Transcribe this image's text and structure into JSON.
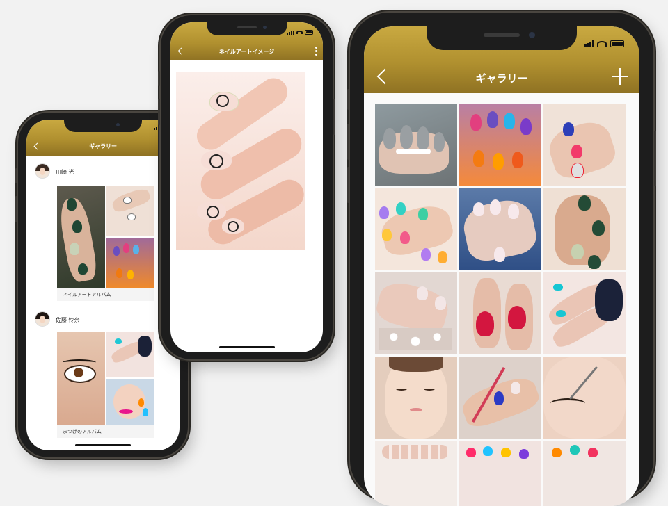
{
  "phones": {
    "left": {
      "nav": {
        "title": "ギャラリー"
      },
      "feed": [
        {
          "user": "川崎 光",
          "album": "ネイルアートアルバム"
        },
        {
          "user": "佐藤 怜奈",
          "album": "まつげのアルバム"
        }
      ]
    },
    "middle": {
      "nav": {
        "title": "ネイルアートイメージ"
      }
    },
    "right": {
      "nav": {
        "title": "ギャラリー"
      },
      "grid_rows": 5,
      "grid_cols": 3
    }
  },
  "colors": {
    "gold_top": "#c9a941",
    "gold_bottom": "#8f7223",
    "background": "#f2f2f2",
    "frame": "#1d1d1d"
  },
  "icons": [
    "back-chevron-icon",
    "plus-icon",
    "more-vertical-icon",
    "signal-icon",
    "wifi-icon",
    "battery-icon"
  ]
}
